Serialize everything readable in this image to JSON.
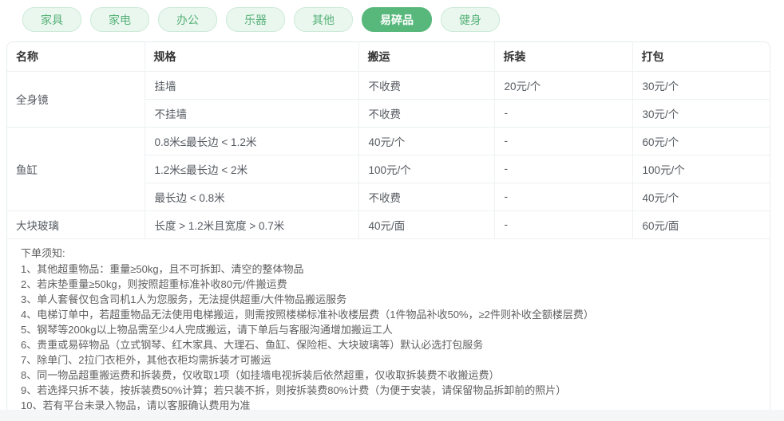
{
  "colors": {
    "accent_green": "#58b87b",
    "tab_bg": "#eaf7ef",
    "tab_border": "#cdead8",
    "tab_text": "#56b177",
    "panel_border": "#e7ecef",
    "row_border": "#edf1f2",
    "header_text": "#333333",
    "cell_text": "#555a60",
    "notes_text": "#5f5f5f"
  },
  "tabs": [
    {
      "label": "家具",
      "active": false
    },
    {
      "label": "家电",
      "active": false
    },
    {
      "label": "办公",
      "active": false
    },
    {
      "label": "乐器",
      "active": false
    },
    {
      "label": "其他",
      "active": false
    },
    {
      "label": "易碎品",
      "active": true
    },
    {
      "label": "健身",
      "active": false
    }
  ],
  "table": {
    "headers": [
      "名称",
      "规格",
      "搬运",
      "拆装",
      "打包"
    ],
    "groups": [
      {
        "name": "全身镜",
        "rows": [
          [
            "挂墙",
            "不收费",
            "20元/个",
            "30元/个"
          ],
          [
            "不挂墙",
            "不收费",
            "-",
            "30元/个"
          ]
        ]
      },
      {
        "name": "鱼缸",
        "rows": [
          [
            "0.8米≤最长边 < 1.2米",
            "40元/个",
            "-",
            "60元/个"
          ],
          [
            "1.2米≤最长边 < 2米",
            "100元/个",
            "-",
            "100元/个"
          ],
          [
            "最长边 < 0.8米",
            "不收费",
            "-",
            "40元/个"
          ]
        ]
      },
      {
        "name": "大块玻璃",
        "rows": [
          [
            "长度 > 1.2米且宽度 > 0.7米",
            "40元/面",
            "-",
            "60元/面"
          ]
        ]
      }
    ]
  },
  "notes": {
    "title": "下单须知:",
    "items": [
      "1、其他超重物品：重量≥50kg，且不可拆卸、清空的整体物品",
      "2、若床垫重量≥50kg，则按照超重标准补收80元/件搬运费",
      "3、单人套餐仅包含司机1人为您服务，无法提供超重/大件物品搬运服务",
      "4、电梯订单中，若超重物品无法使用电梯搬运，则需按照楼梯标准补收楼层费（1件物品补收50%，≥2件则补收全额楼层费）",
      "5、钢琴等200kg以上物品需至少4人完成搬运，请下单后与客服沟通增加搬运工人",
      "6、贵重或易碎物品（立式钢琴、红木家具、大理石、鱼缸、保险柜、大块玻璃等）默认必选打包服务",
      "7、除单门、2拉门衣柜外，其他衣柜均需拆装才可搬运",
      "8、同一物品超重搬运费和拆装费，仅收取1项（如挂墙电视拆装后依然超重，仅收取拆装费不收搬运费）",
      "9、若选择只拆不装，按拆装费50%计算；若只装不拆，则按拆装费80%计费（为便于安装，请保留物品拆卸前的照片）",
      "10、若有平台未录入物品，请以客服确认费用为准"
    ]
  }
}
